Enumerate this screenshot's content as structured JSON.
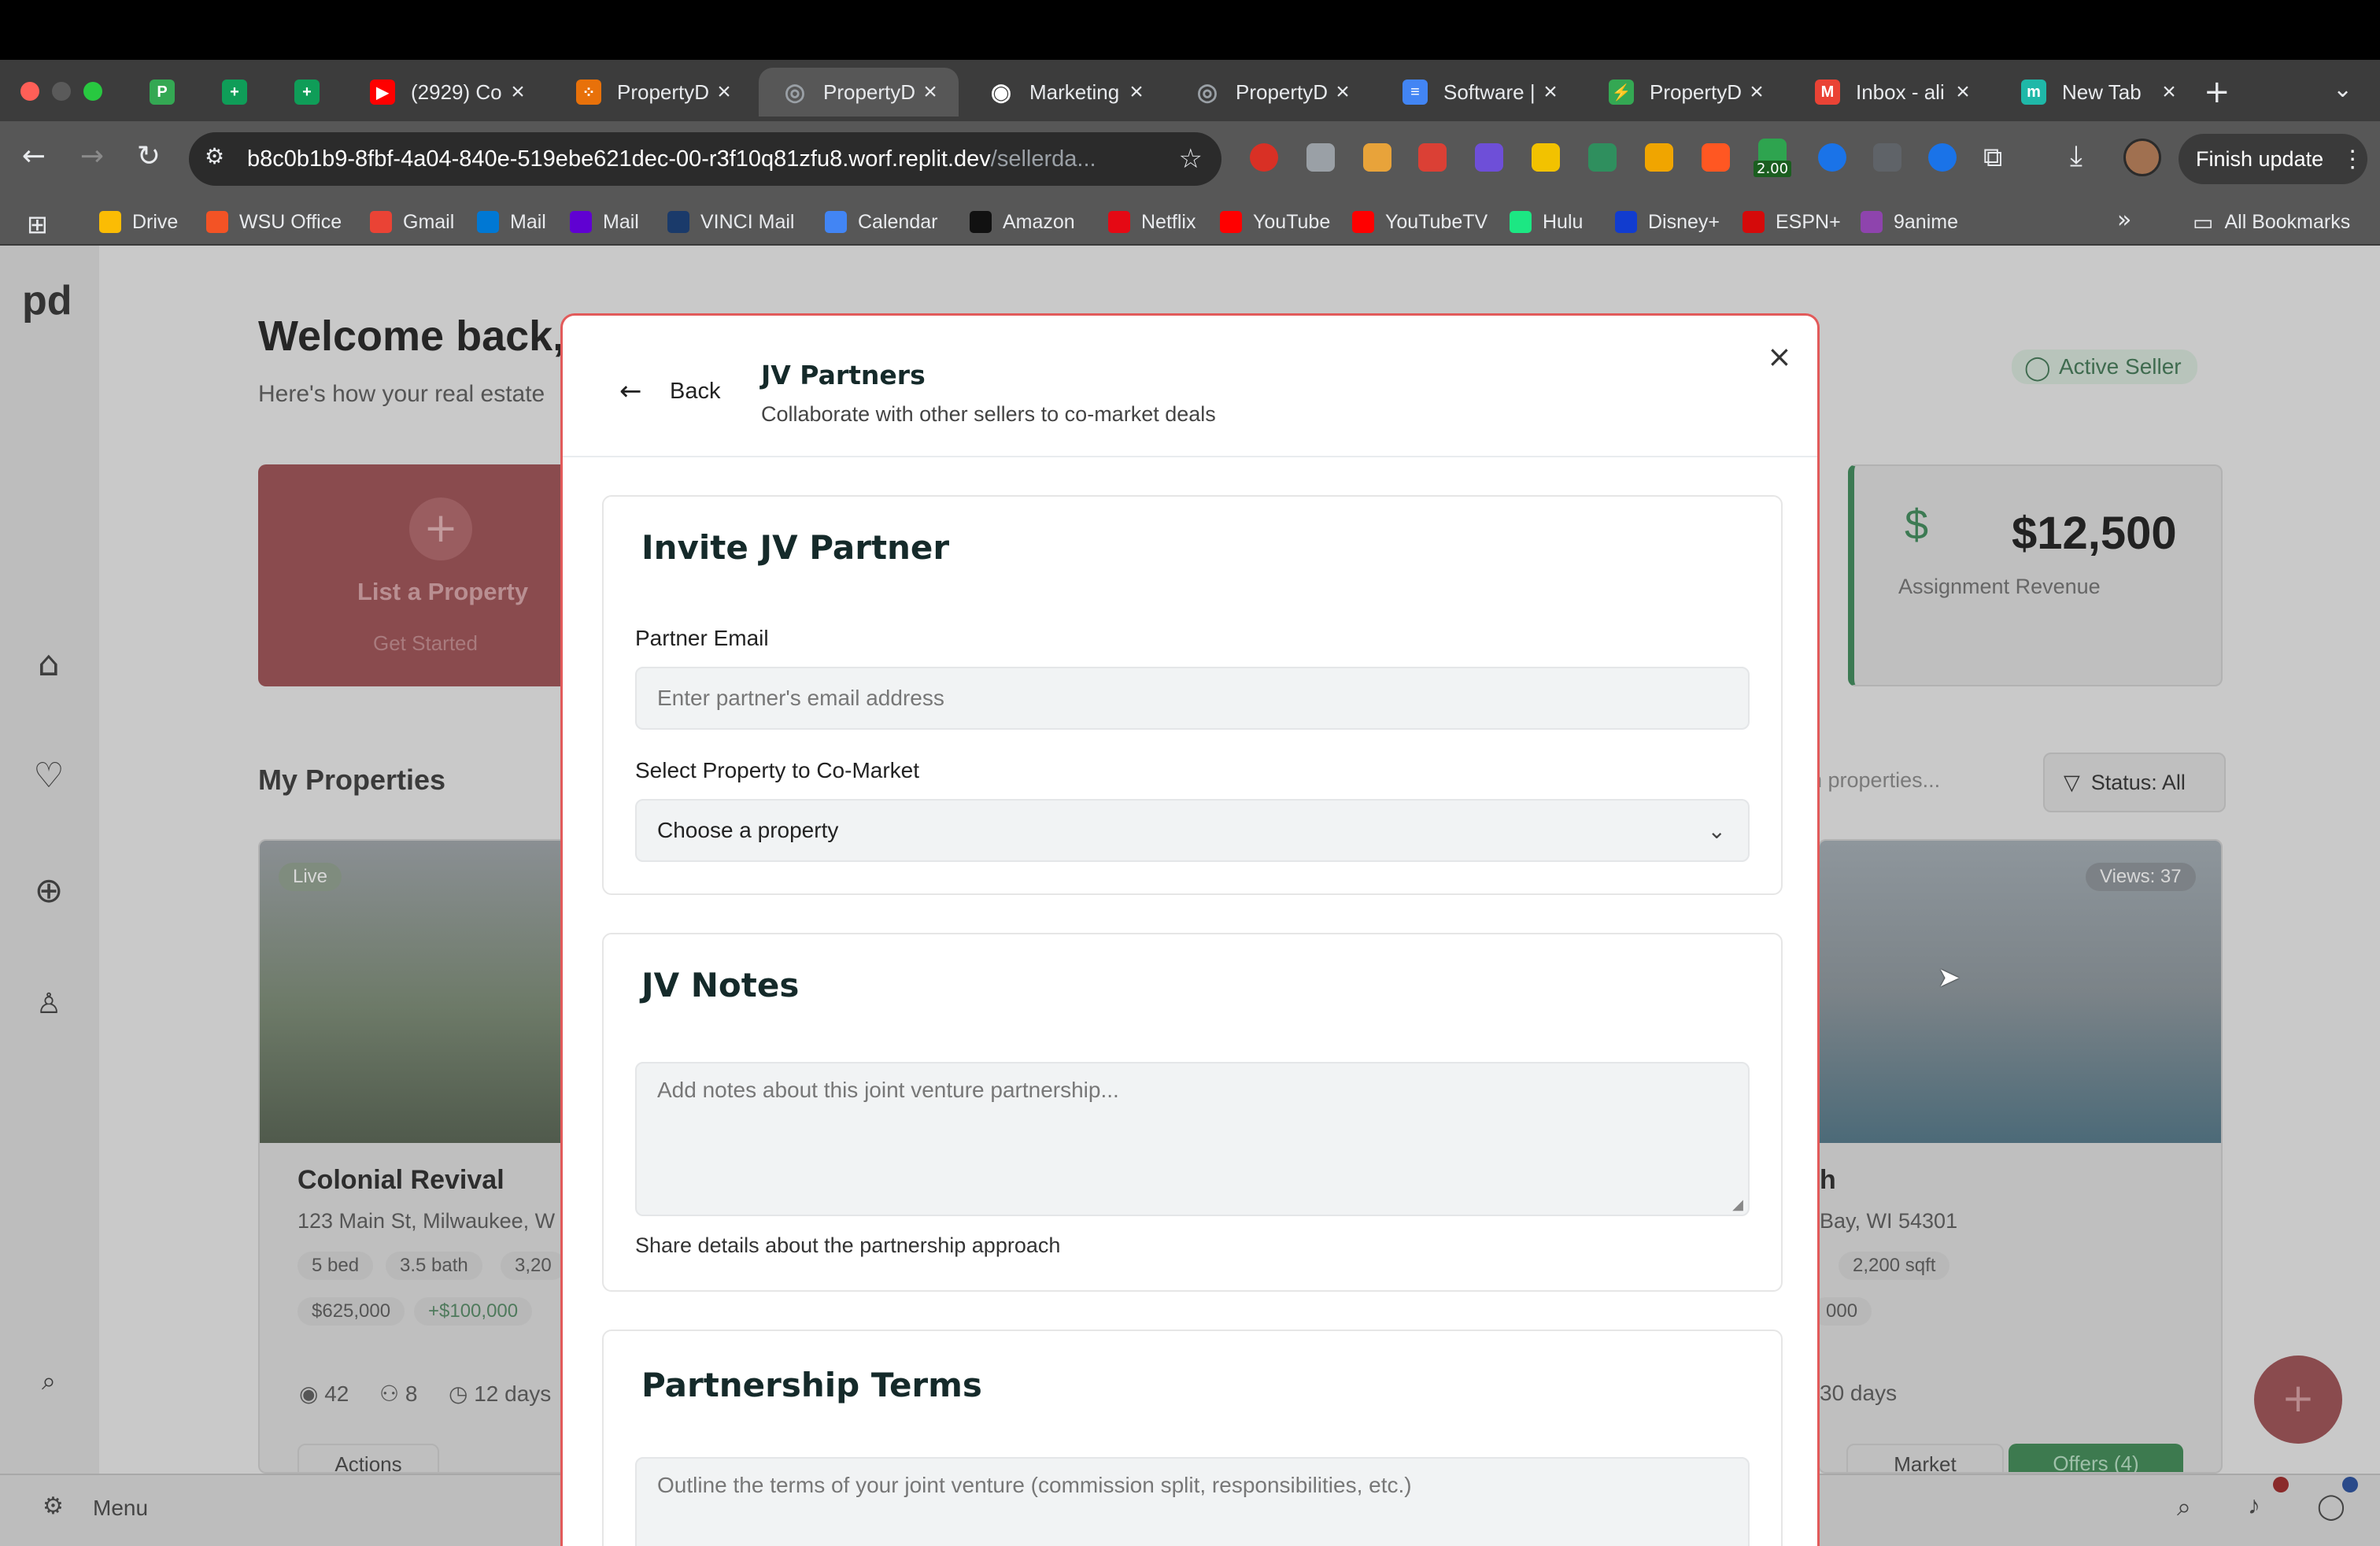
{
  "browser": {
    "tabs": [
      {
        "favicon": "P",
        "color": "#34a853",
        "title": ""
      },
      {
        "favicon": "+",
        "color": "#0f9d58",
        "title": ""
      },
      {
        "favicon": "+",
        "color": "#0f9d58",
        "title": ""
      },
      {
        "favicon": "▶",
        "color": "#ff0000",
        "title": "(2929) Co"
      },
      {
        "favicon": "⁘",
        "color": "#e8710a",
        "title": "PropertyD"
      },
      {
        "favicon": "◎",
        "color": "#9aa0a6",
        "title": "PropertyD"
      },
      {
        "favicon": "◉",
        "color": "#ffffff",
        "title": "Marketing"
      },
      {
        "favicon": "◎",
        "color": "#9aa0a6",
        "title": "PropertyD"
      },
      {
        "favicon": "≡",
        "color": "#4285f4",
        "title": "Software |"
      },
      {
        "favicon": "⚡",
        "color": "#34a853",
        "title": "PropertyD"
      },
      {
        "favicon": "M",
        "color": "#ea4335",
        "title": "Inbox - ali"
      },
      {
        "favicon": "m",
        "color": "#1fb8a8",
        "title": "New Tab"
      }
    ],
    "url_main": "b8c0b1b9-8fbf-4a04-840e-519ebe621dec-00-r3f10q81zfu8.worf.replit.dev",
    "url_path": "/sellerda...",
    "finish_update": "Finish update",
    "extension_badge": "2.00",
    "bookmarks": [
      {
        "label": "Drive",
        "color": "#fbbc04"
      },
      {
        "label": "WSU Office",
        "color": "#f35325"
      },
      {
        "label": "Gmail",
        "color": "#ea4335"
      },
      {
        "label": "Mail",
        "color": "#0078d4"
      },
      {
        "label": "Mail",
        "color": "#6001d2"
      },
      {
        "label": "VINCI Mail",
        "color": "#1a3a6a"
      },
      {
        "label": "Calendar",
        "color": "#4285f4"
      },
      {
        "label": "Amazon",
        "color": "#111111"
      },
      {
        "label": "Netflix",
        "color": "#e50914"
      },
      {
        "label": "YouTube",
        "color": "#ff0000"
      },
      {
        "label": "YouTubeTV",
        "color": "#ff0000"
      },
      {
        "label": "Hulu",
        "color": "#1ce783"
      },
      {
        "label": "Disney+",
        "color": "#113ccf"
      },
      {
        "label": "ESPN+",
        "color": "#d50a0a"
      },
      {
        "label": "9anime",
        "color": "#8e44ad"
      }
    ],
    "all_bookmarks": "All Bookmarks"
  },
  "background": {
    "logo": "pd",
    "welcome": "Welcome back,",
    "subtitle": "Here's how your real estate",
    "active_seller": "Active Seller",
    "list_property": "List a Property",
    "get_started": "Get Started",
    "revenue_value": "$12,500",
    "revenue_label": "Assignment Revenue",
    "my_properties": "My Properties",
    "search_placeholder": "h properties...",
    "status_filter": "Status: All",
    "live_badge": "Live",
    "views_badge": "Views: 37",
    "property_title": "Colonial Revival",
    "property_address": "123 Main St, Milwaukee, W",
    "property2_title": "h",
    "property2_address": "Bay, WI 54301",
    "beds": "5 bed",
    "baths": "3.5 bath",
    "sqft_partial": "3,20",
    "sqft2": "2,200 sqft",
    "price": "$625,000",
    "gain": "+$100,000",
    "price2_partial": "000",
    "views_count": "42",
    "people_count": "8",
    "days": "12 days",
    "days2": "30 days",
    "actions": "Actions",
    "market": "Market",
    "offers": "Offers (4)",
    "menu": "Menu"
  },
  "modal": {
    "back": "Back",
    "title": "JV Partners",
    "subtitle": "Collaborate with other sellers to co-market deals",
    "invite": {
      "title": "Invite JV Partner",
      "email_label": "Partner Email",
      "email_placeholder": "Enter partner's email address",
      "property_label": "Select Property to Co-Market",
      "property_value": "Choose a property"
    },
    "notes": {
      "title": "JV Notes",
      "placeholder": "Add notes about this joint venture partnership...",
      "help": "Share details about the partnership approach"
    },
    "terms": {
      "title": "Partnership Terms",
      "placeholder": "Outline the terms of your joint venture (commission split, responsibilities, etc.)"
    }
  }
}
